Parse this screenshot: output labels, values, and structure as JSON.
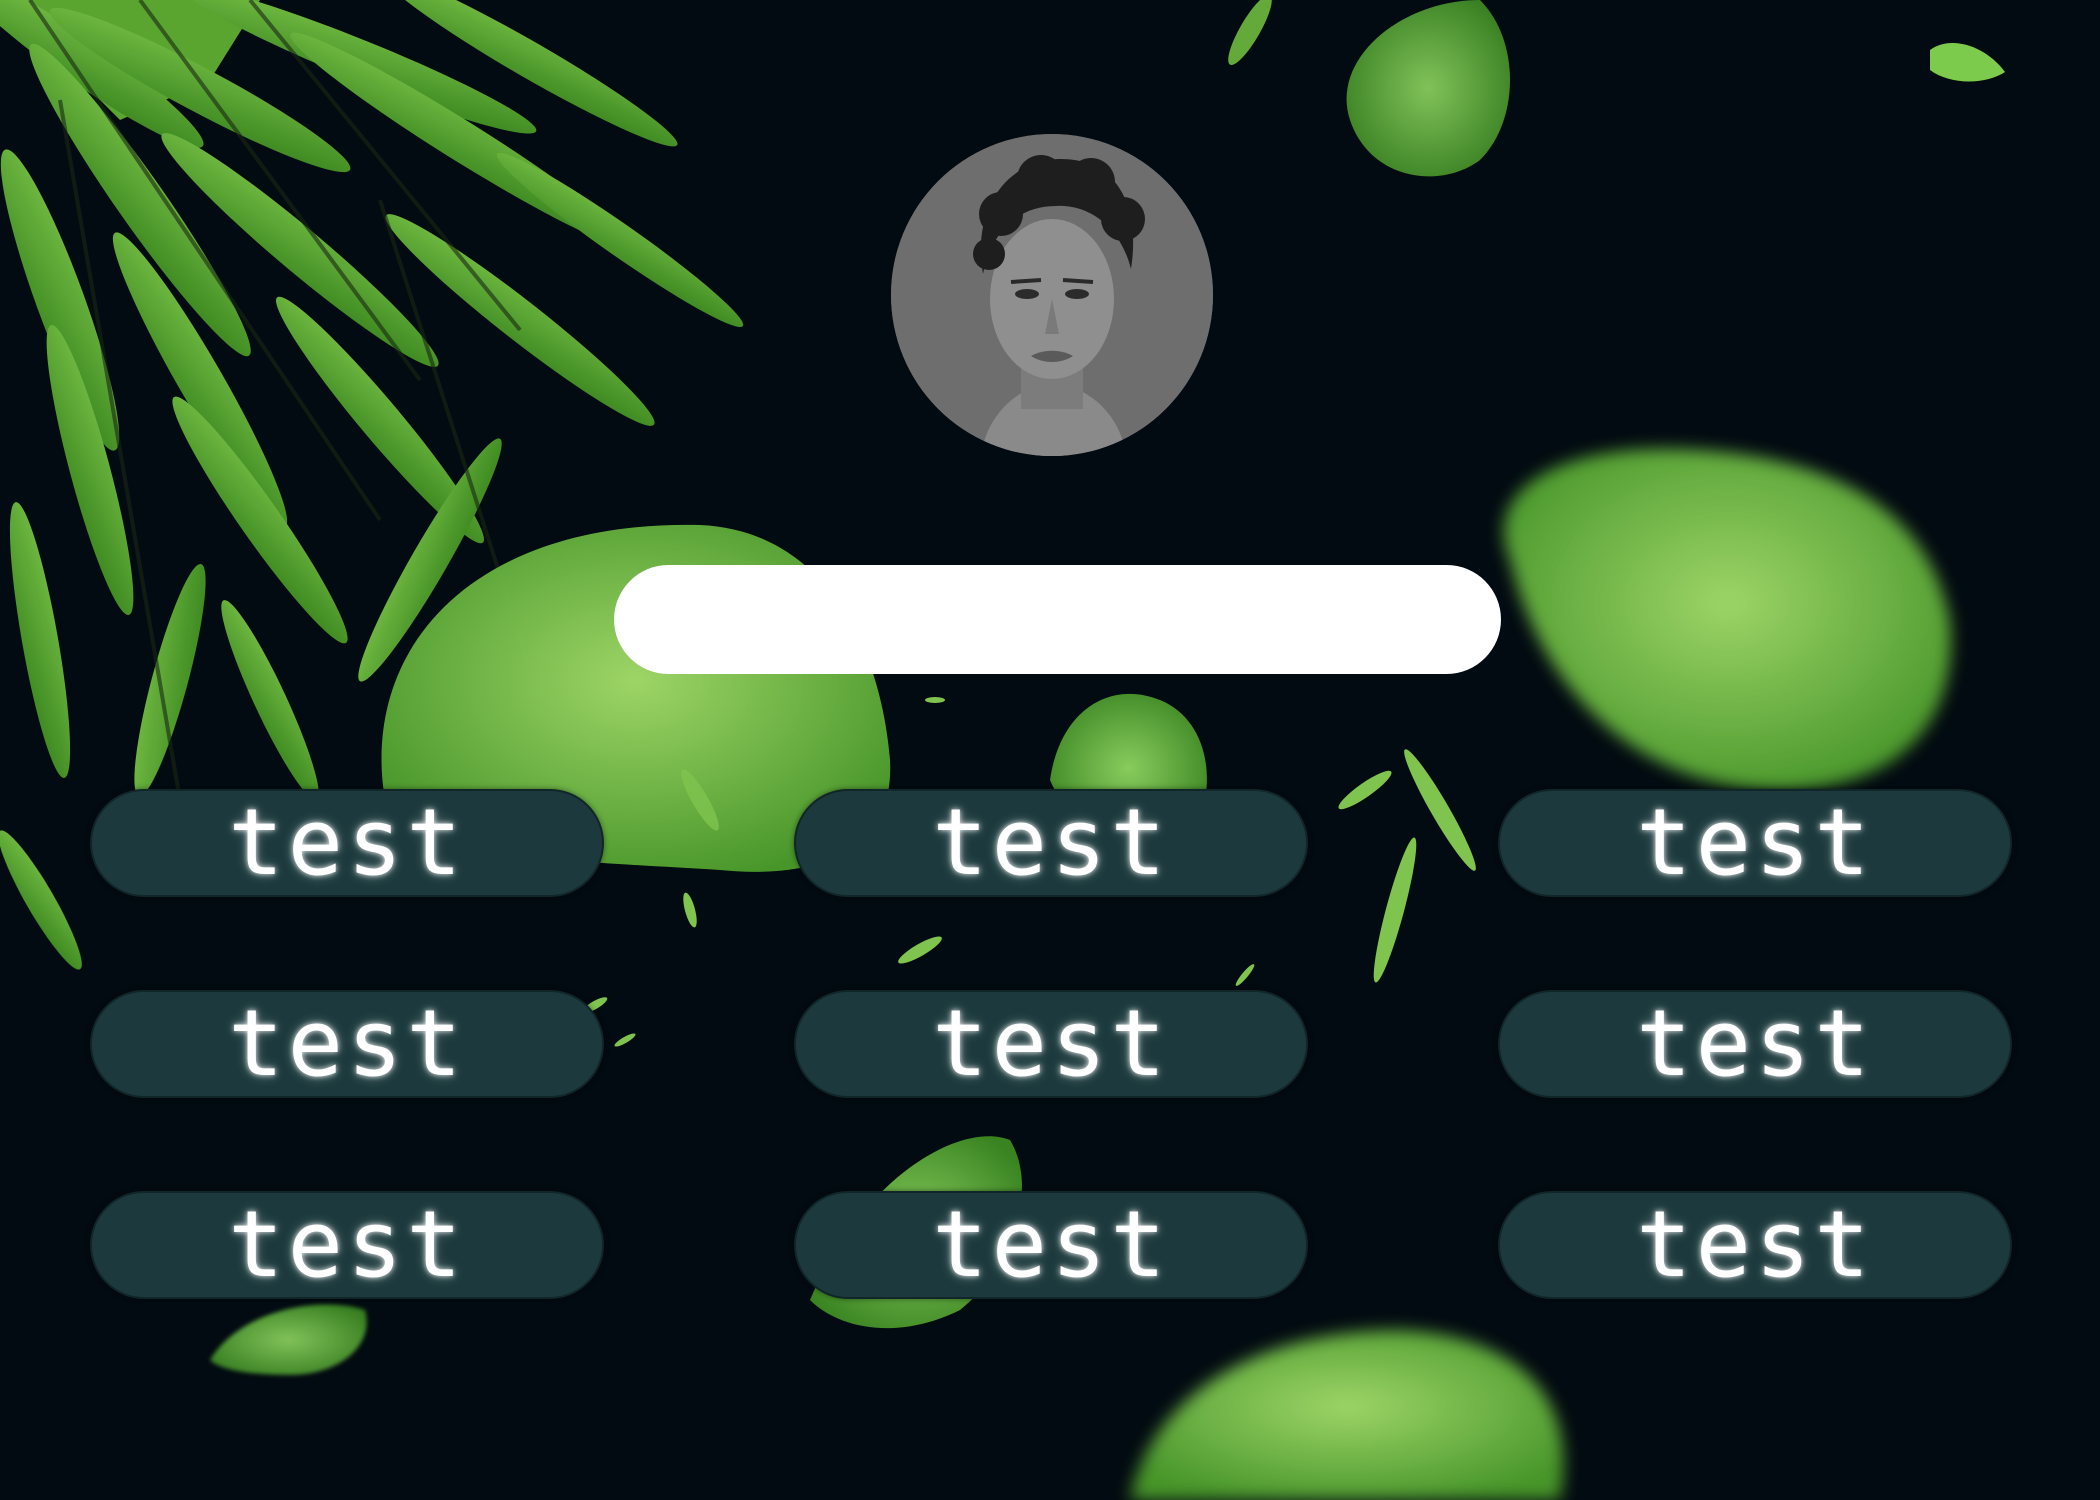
{
  "search": {
    "value": "",
    "placeholder": ""
  },
  "avatar": {
    "icon": "portrait-photo"
  },
  "buttons": [
    {
      "label": "test"
    },
    {
      "label": "test"
    },
    {
      "label": "test"
    },
    {
      "label": "test"
    },
    {
      "label": "test"
    },
    {
      "label": "test"
    },
    {
      "label": "test"
    },
    {
      "label": "test"
    },
    {
      "label": "test"
    }
  ],
  "theme": {
    "background": "#030b12",
    "button_fill": "#1c3a3d",
    "leaf_light": "#8fd15a",
    "leaf_dark": "#3f8f22"
  }
}
